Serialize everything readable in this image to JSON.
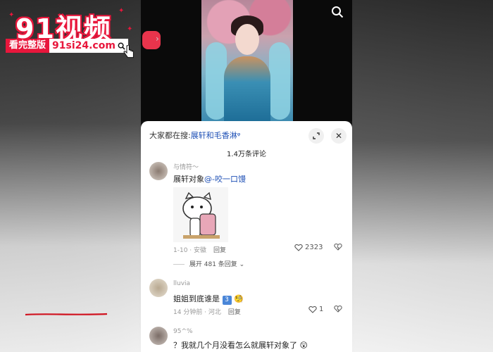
{
  "watermark": {
    "title": "91视频",
    "tag": "看完整版",
    "url": "91si24.com"
  },
  "video": {
    "progress_label": ""
  },
  "sheet": {
    "search_prefix": "大家都在搜:",
    "search_keyword": "展轩和毛香淋",
    "comment_count": "1.4万条评论"
  },
  "comments": [
    {
      "user": "与情符～",
      "text_plain": "展轩对象",
      "mention": "@-咬一口馒",
      "meta_time": "1-10 · 安徽",
      "reply_label": "回复",
      "likes": "2323",
      "expand_label": "展开 481 条回复"
    },
    {
      "user": "lluvia",
      "text_plain": "姐姐到底谁是",
      "emoji_badge": "3",
      "meta_time": "14 分钟前 · 河北",
      "reply_label": "回复",
      "likes": "1"
    },
    {
      "user": "95^%",
      "text_plain": "？我就几个月没看怎么就展轩对象了"
    }
  ],
  "colors": {
    "brand_red": "#e8173c",
    "link_blue": "#1d4fb5"
  }
}
